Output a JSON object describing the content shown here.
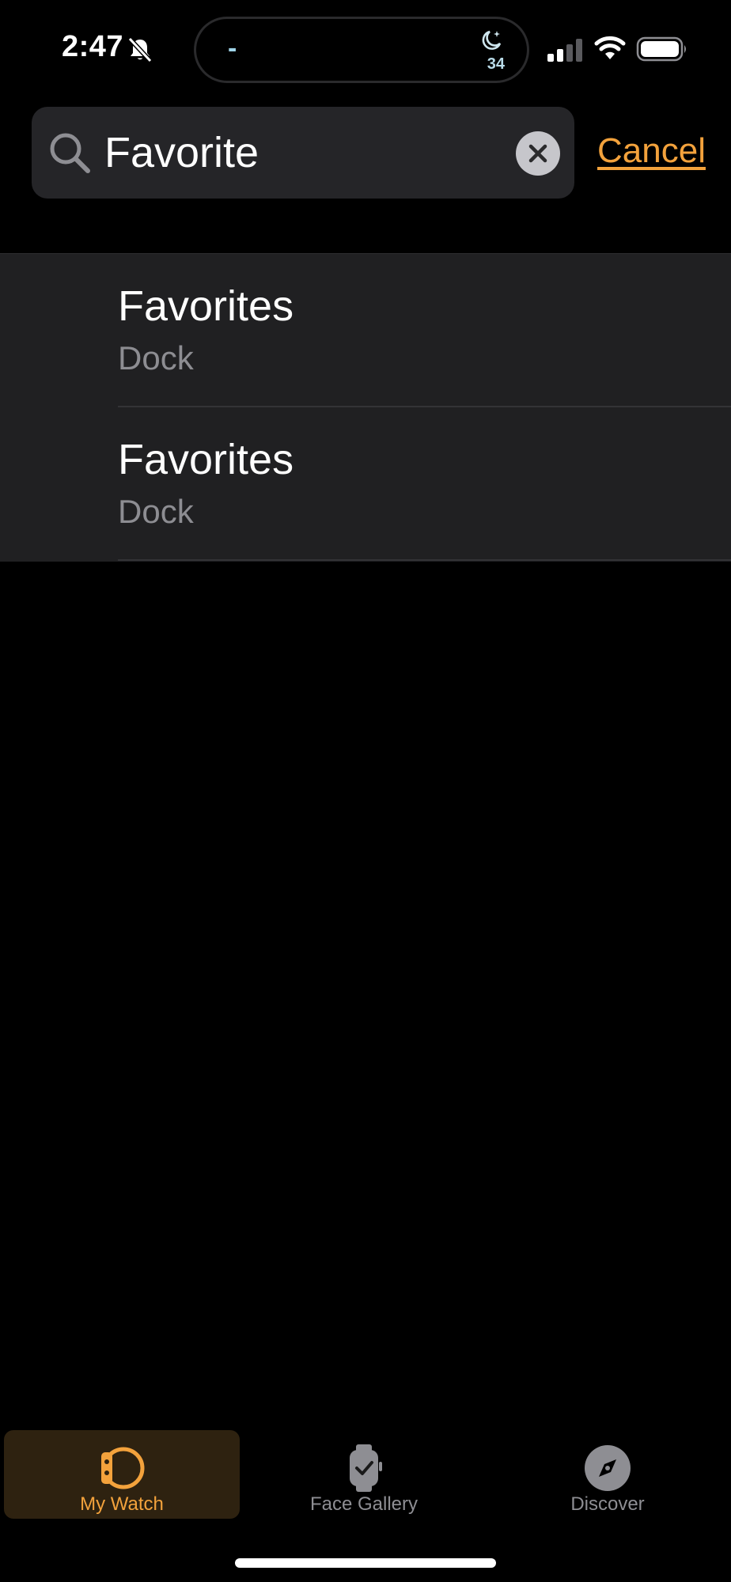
{
  "status_bar": {
    "time": "2:47",
    "island_indicator": "-",
    "island_count": "34",
    "icons": [
      "bell-slash-icon",
      "moon-icon",
      "signal-icon",
      "wifi-icon",
      "battery-icon"
    ]
  },
  "search": {
    "value": "Favorite",
    "cancel_label": "Cancel"
  },
  "results": [
    {
      "title": "Favorites",
      "subtitle": "Dock"
    },
    {
      "title": "Favorites",
      "subtitle": "Dock"
    }
  ],
  "tab_bar": {
    "tabs": [
      {
        "label": "My Watch",
        "icon": "watch-icon",
        "active": true
      },
      {
        "label": "Face Gallery",
        "icon": "face-gallery-icon",
        "active": false
      },
      {
        "label": "Discover",
        "icon": "compass-icon",
        "active": false
      }
    ]
  },
  "colors": {
    "accent": "#f3a23c",
    "background": "#000000",
    "cell_background": "#202022",
    "secondary_text": "#8d8d92"
  }
}
